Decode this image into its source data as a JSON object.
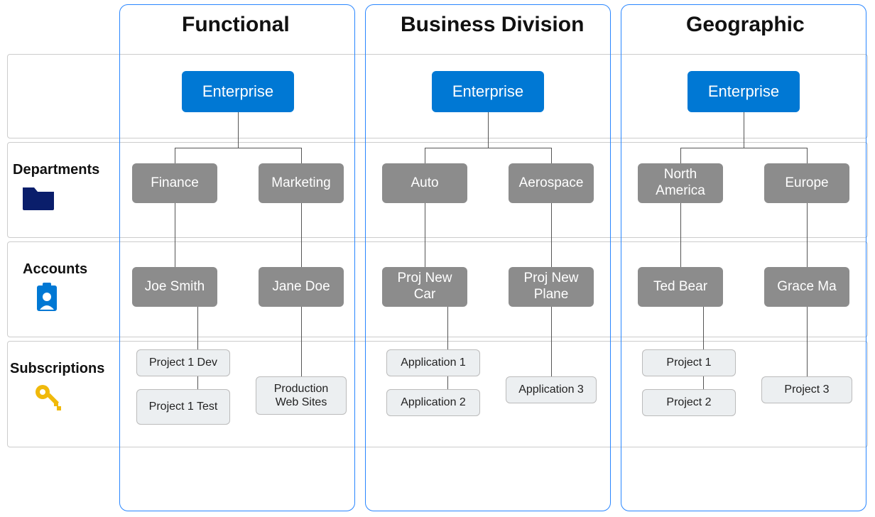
{
  "columns": [
    {
      "title": "Functional"
    },
    {
      "title": "Business Division"
    },
    {
      "title": "Geographic"
    }
  ],
  "rowLabels": {
    "departments": "Departments",
    "accounts": "Accounts",
    "subscriptions": "Subscriptions"
  },
  "enterprise_label": "Enterprise",
  "functional": {
    "dept_left": "Finance",
    "dept_right": "Marketing",
    "acct_left": "Joe Smith",
    "acct_right": "Jane Doe",
    "sub_left1": "Project 1 Dev",
    "sub_left2": "Project 1 Test",
    "sub_right1": "Production Web Sites"
  },
  "business": {
    "dept_left": "Auto",
    "dept_right": "Aerospace",
    "acct_left": "Proj New Car",
    "acct_right": "Proj New Plane",
    "sub_left1": "Application 1",
    "sub_left2": "Application 2",
    "sub_right1": "Application 3"
  },
  "geographic": {
    "dept_left": "North America",
    "dept_right": "Europe",
    "acct_left": "Ted Bear",
    "acct_right": "Grace Ma",
    "sub_left1": "Project 1",
    "sub_left2": "Project 2",
    "sub_right1": "Project 3"
  }
}
